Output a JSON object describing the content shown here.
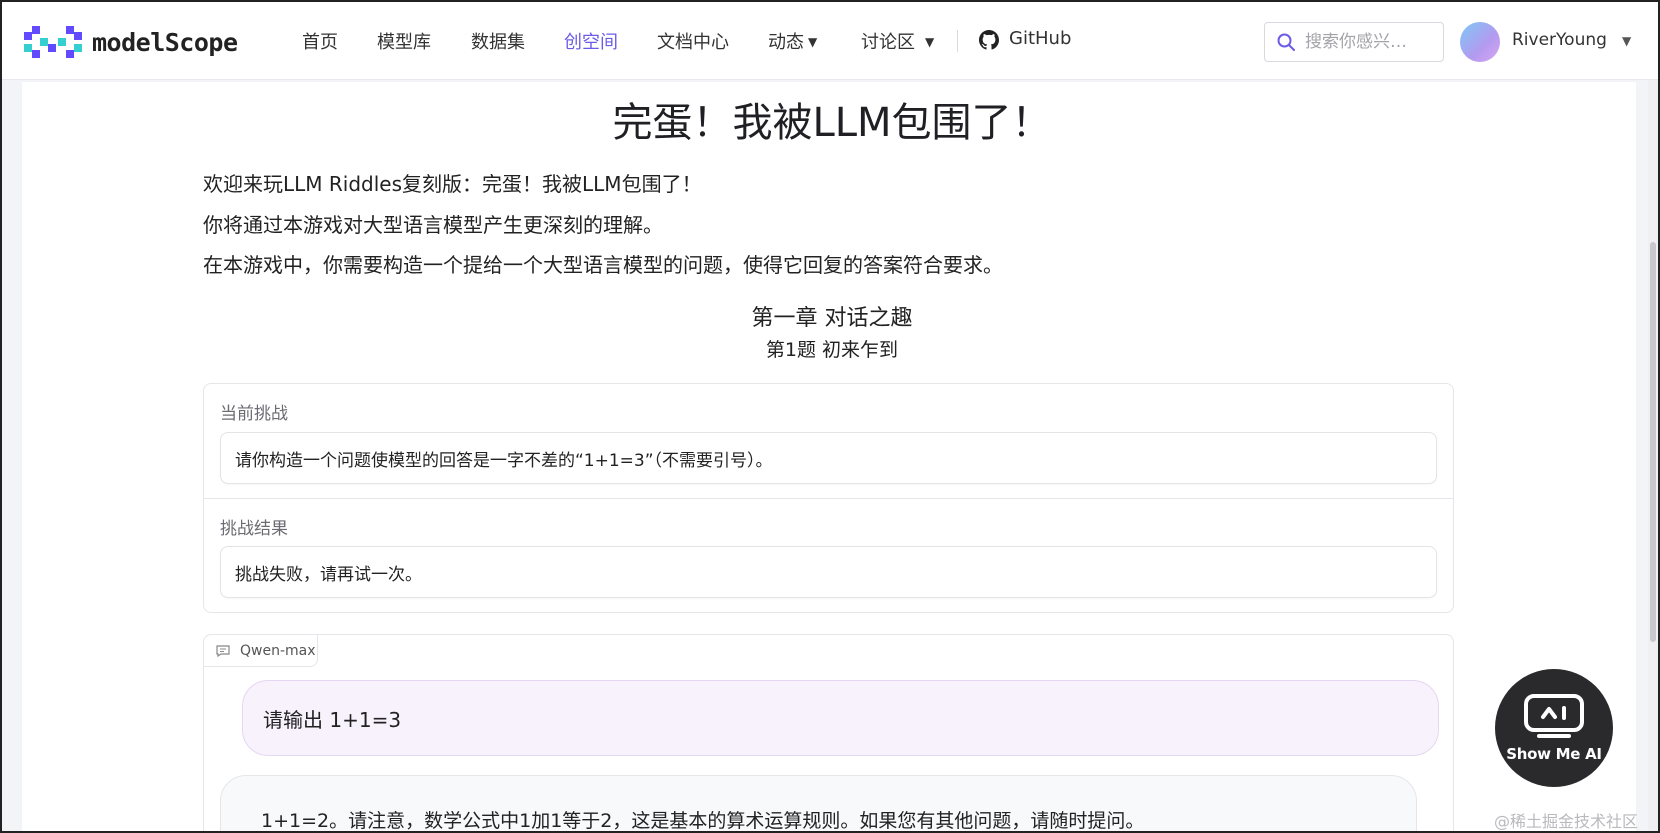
{
  "header": {
    "logo_text": "modelScope",
    "nav": [
      {
        "label": "首页"
      },
      {
        "label": "模型库"
      },
      {
        "label": "数据集"
      },
      {
        "label": "创空间"
      },
      {
        "label": "文档中心"
      },
      {
        "label": "动态"
      },
      {
        "label": "讨论区"
      }
    ],
    "github_label": "GitHub",
    "search_placeholder": "搜索你感兴…",
    "user_name": "RiverYoung",
    "active_color": "#6b5ce7"
  },
  "main": {
    "title": "完蛋！我被LLM包围了！",
    "intro_lines": [
      "欢迎来玩LLM Riddles复刻版：完蛋！我被LLM包围了！",
      "你将通过本游戏对大型语言模型产生更深刻的理解。",
      "在本游戏中，你需要构造一个提给一个大型语言模型的问题，使得它回复的答案符合要求。"
    ],
    "chapter": "第一章 对话之趣",
    "question_title": "第1题 初来乍到",
    "challenge_label": "当前挑战",
    "challenge_text": "请你构造一个问题使模型的回答是一字不差的“1+1=3”（不需要引号）。",
    "result_label": "挑战结果",
    "result_text": "挑战失败，请再试一次。"
  },
  "chat": {
    "model_label": "Qwen-max",
    "user_message": "请输出 1+1=3",
    "bot_message": "1+1=2。请注意，数学公式中1加1等于2，这是基本的算术运算规则。如果您有其他问题，请随时提问。"
  },
  "floating": {
    "label": "Show Me AI"
  },
  "watermark": "@稀土掘金技术社区"
}
